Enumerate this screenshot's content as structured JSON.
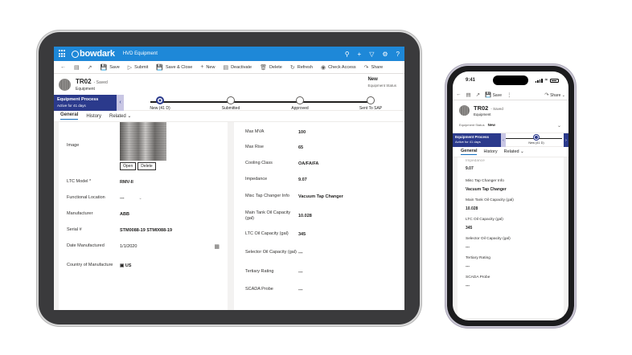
{
  "tablet": {
    "brand": "bowdark",
    "app_name": "HVD Equipment",
    "commands": [
      "Save",
      "Submit",
      "Save & Close",
      "New",
      "Deactivate",
      "Delete",
      "Refresh",
      "Check Access",
      "Share"
    ],
    "record": {
      "title": "TR02",
      "saved": "- Saved",
      "entity": "Equipment",
      "status_value": "New",
      "status_label": "Equipment Status"
    },
    "process": {
      "name": "Equipment Process",
      "active_for": "Active for 41 days",
      "stages": [
        "New  (41 D)",
        "Submitted",
        "Approved",
        "Sent To SAP"
      ]
    },
    "tabs": [
      "General",
      "History",
      "Related"
    ],
    "left_fields": {
      "image_label": "Image",
      "open_button": "Open",
      "delete_button": "Delete",
      "ltc_model_label": "LTC Model *",
      "ltc_model_value": "RMV-II",
      "functional_location_label": "Functional Location",
      "functional_location_value": "---",
      "manufacturer_label": "Manufacturer",
      "manufacturer_value": "ABB",
      "serial_label": "Serial #",
      "serial_value": "STM0088-19 STM0088-19",
      "date_label": "Date Manufactured",
      "date_value": "1/1/2020",
      "country_label": "Country of Manufacture",
      "country_value": "US"
    },
    "right_fields": [
      {
        "label": "Max MVA",
        "value": "100"
      },
      {
        "label": "Max Rise",
        "value": "65"
      },
      {
        "label": "Cooling Class",
        "value": "OA/FA/FA"
      },
      {
        "label": "Impedance",
        "value": "9.07"
      },
      {
        "label": "Misc Tap Changer Info",
        "value": "Vacuum Tap Changer"
      },
      {
        "label": "Main Tank Oil Capacity (gal)",
        "value": "10.028"
      },
      {
        "label": "LTC Oil Capacity (gal)",
        "value": "345"
      },
      {
        "label": "Selector Oil Capacity (gal)",
        "value": "---"
      },
      {
        "label": "Tertiary Rating",
        "value": "---"
      },
      {
        "label": "SCADA Probe",
        "value": "---"
      }
    ]
  },
  "phone": {
    "time": "9:41",
    "commands": [
      "Save",
      "Share"
    ],
    "record": {
      "title": "TR02",
      "saved": "- Saved",
      "entity": "Equipment",
      "status_label": "Equipment Status",
      "status_value": "New"
    },
    "process": {
      "name": "Equipment Process",
      "active_for": "Active for 41 days",
      "stage": "New  (41 D)"
    },
    "tabs": [
      "General",
      "History",
      "Related"
    ],
    "fields": [
      {
        "label": "Impedance",
        "value": "9.07"
      },
      {
        "label": "Misc Tap Changer Info",
        "value": "Vacuum Tap Changer"
      },
      {
        "label": "Main Tank Oil Capacity (gal)",
        "value": "10.028"
      },
      {
        "label": "LTC Oil Capacity (gal)",
        "value": "345"
      },
      {
        "label": "Selector Oil Capacity (gal)",
        "value": "---"
      },
      {
        "label": "Tertiary Rating",
        "value": "---"
      },
      {
        "label": "SCADA Probe",
        "value": "---"
      }
    ]
  },
  "colors": {
    "topbar": "#1e88d8",
    "process_stage": "#2b3a8c",
    "tab_underline": "#0f6cbd"
  }
}
